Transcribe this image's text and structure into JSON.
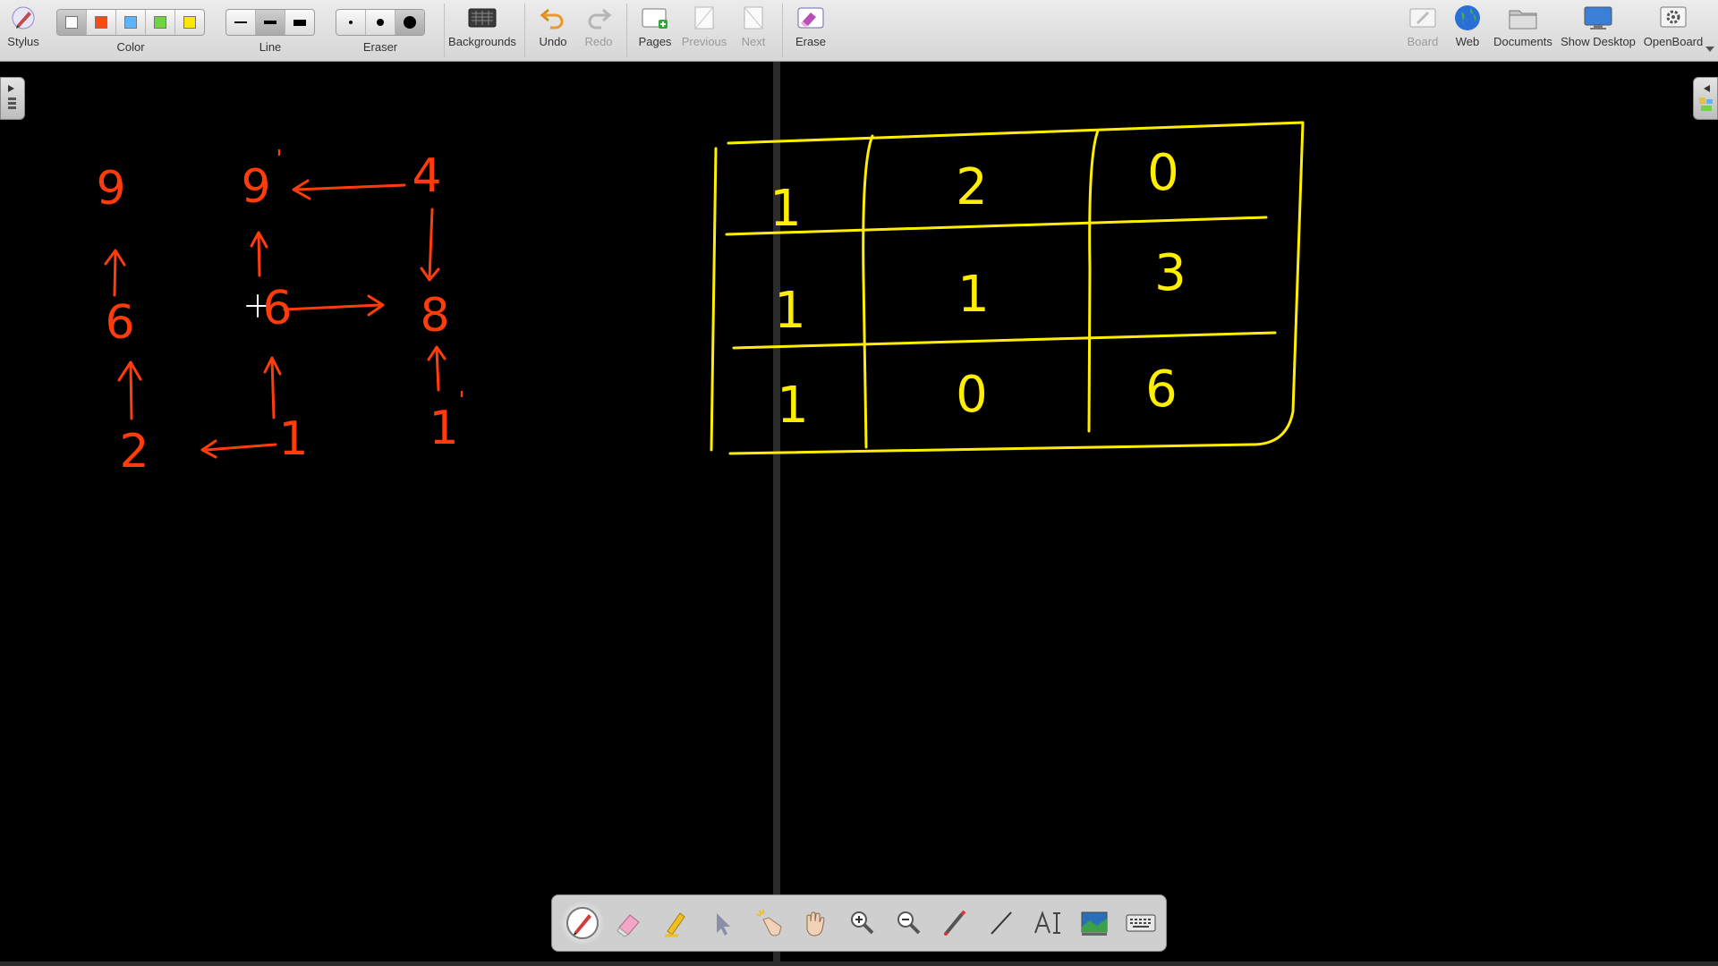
{
  "toolbar": {
    "stylus": "Stylus",
    "color": "Color",
    "line": "Line",
    "eraser": "Eraser",
    "backgrounds": "Backgrounds",
    "undo": "Undo",
    "redo": "Redo",
    "pages": "Pages",
    "previous": "Previous",
    "next": "Next",
    "erase": "Erase",
    "board": "Board",
    "web": "Web",
    "documents": "Documents",
    "show_desktop": "Show Desktop",
    "openboard": "OpenBoard"
  },
  "colors": {
    "palette": [
      "#ffffff",
      "#ff4b12",
      "#5ab4ff",
      "#6ed63c",
      "#ffe600"
    ],
    "ink_orange": "#ff3c0a",
    "ink_yellow": "#ffee00",
    "board_bg": "#000000"
  },
  "drawing": {
    "left_digits": [
      "9",
      "9",
      "4",
      "6",
      "6",
      "8",
      "2",
      "1",
      "1"
    ],
    "primes": [
      "'",
      "'"
    ],
    "grid_cells": [
      "1",
      "2",
      "0",
      "1",
      "1",
      "3",
      "1",
      "0",
      "6"
    ]
  },
  "dock_tools": [
    "pen-icon",
    "eraser-icon",
    "highlighter-icon",
    "pointer-icon",
    "laser-hand-icon",
    "hand-icon",
    "zoom-in-icon",
    "zoom-out-icon",
    "laser-pen-icon",
    "line-icon",
    "text-icon",
    "capture-icon",
    "keyboard-icon"
  ]
}
